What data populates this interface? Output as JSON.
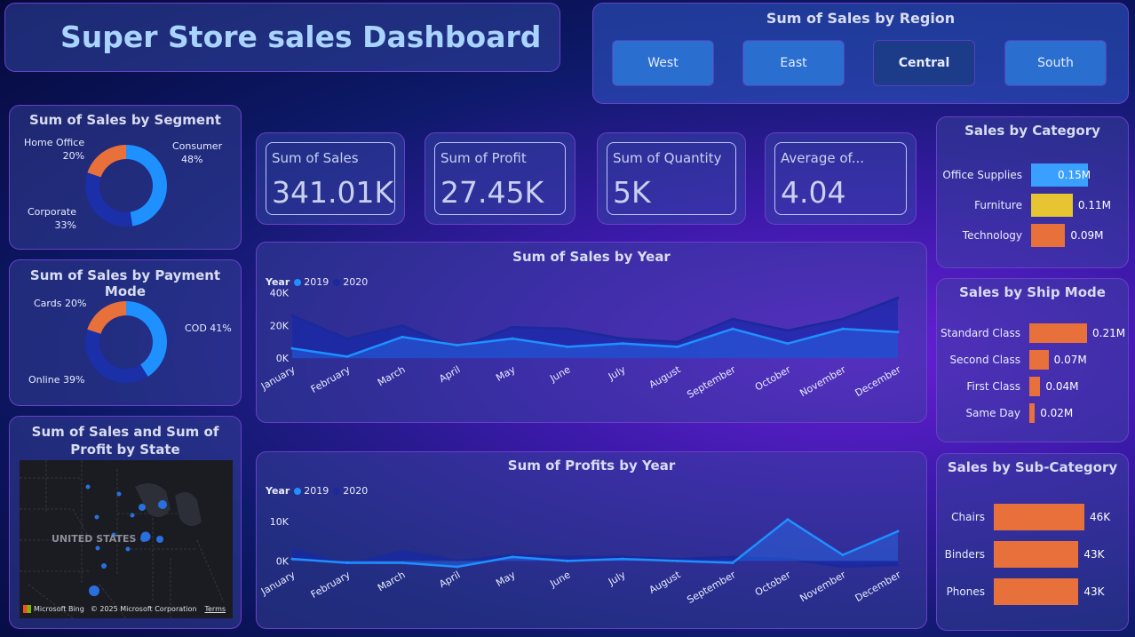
{
  "header": {
    "title": "Super Store sales Dashboard"
  },
  "region": {
    "title": "Sum of Sales by Region",
    "buttons": [
      "West",
      "East",
      "Central",
      "South"
    ],
    "selected": "Central"
  },
  "kpis": [
    {
      "label": "Sum of Sales",
      "value": "341.01K"
    },
    {
      "label": "Sum of Profit",
      "value": "27.45K"
    },
    {
      "label": "Sum of Quantity",
      "value": "5K"
    },
    {
      "label": "Average of...",
      "value": "4.04"
    }
  ],
  "segment": {
    "title": "Sum of Sales by Segment",
    "slices": [
      {
        "name": "Consumer",
        "pct": "48%"
      },
      {
        "name": "Corporate",
        "pct": "33%"
      },
      {
        "name": "Home Office",
        "pct": "20%"
      }
    ]
  },
  "payment": {
    "title": "Sum of Sales by Payment Mode",
    "slices": [
      {
        "label": "COD 41%"
      },
      {
        "label": "Online 39%"
      },
      {
        "label": "Cards 20%"
      }
    ]
  },
  "map": {
    "title": "Sum of Sales and Sum of Profit by State",
    "country_label": "UNITED STATES",
    "attribution": "© 2025 Microsoft Corporation",
    "terms": "Terms",
    "brand": "Microsoft Bing"
  },
  "sales_year": {
    "title": "Sum of Sales by Year",
    "legend_title": "Year",
    "yticks": [
      "40K",
      "20K",
      "0K"
    ]
  },
  "profit_year": {
    "title": "Sum of Profits by Year",
    "legend_title": "Year",
    "yticks": [
      "10K",
      "0K"
    ]
  },
  "category": {
    "title": "Sales by Category",
    "items": [
      {
        "name": "Office Supplies",
        "label": "0.15M",
        "value": 0.15,
        "color": "#3aa0ff"
      },
      {
        "name": "Furniture",
        "label": "0.11M",
        "value": 0.11,
        "color": "#e6c432"
      },
      {
        "name": "Technology",
        "label": "0.09M",
        "value": 0.09,
        "color": "#e8703a"
      }
    ]
  },
  "shipmode": {
    "title": "Sales by Ship Mode",
    "items": [
      {
        "name": "Standard Class",
        "label": "0.21M",
        "value": 0.21
      },
      {
        "name": "Second Class",
        "label": "0.07M",
        "value": 0.07
      },
      {
        "name": "First Class",
        "label": "0.04M",
        "value": 0.04
      },
      {
        "name": "Same Day",
        "label": "0.02M",
        "value": 0.02
      }
    ]
  },
  "subcategory": {
    "title": "Sales by Sub-Category",
    "items": [
      {
        "name": "Chairs",
        "label": "46K",
        "value": 46
      },
      {
        "name": "Binders",
        "label": "43K",
        "value": 43
      },
      {
        "name": "Phones",
        "label": "43K",
        "value": 43
      }
    ]
  },
  "colors": {
    "series_2019": "#1e90ff",
    "series_2020": "#1a2a9a",
    "accent_orange": "#e8703a"
  },
  "chart_data": [
    {
      "type": "area",
      "title": "Sum of Sales by Year",
      "x": [
        "January",
        "February",
        "March",
        "April",
        "May",
        "June",
        "July",
        "August",
        "September",
        "October",
        "November",
        "December"
      ],
      "ylim": [
        0,
        40000
      ],
      "series": [
        {
          "name": "2019",
          "values": [
            6000,
            1000,
            13000,
            8000,
            12000,
            7000,
            9000,
            7000,
            18000,
            9000,
            18000,
            16000
          ]
        },
        {
          "name": "2020",
          "values": [
            26000,
            12000,
            20000,
            6000,
            19000,
            18000,
            12000,
            10000,
            24000,
            17000,
            24000,
            37000
          ]
        }
      ]
    },
    {
      "type": "area",
      "title": "Sum of Profits by Year",
      "x": [
        "January",
        "February",
        "March",
        "April",
        "May",
        "June",
        "July",
        "August",
        "September",
        "October",
        "November",
        "December"
      ],
      "ylim": [
        -2000,
        12000
      ],
      "series": [
        {
          "name": "2019",
          "values": [
            500,
            -500,
            -500,
            -1500,
            1000,
            0,
            500,
            0,
            -500,
            10500,
            1500,
            7500
          ]
        },
        {
          "name": "2020",
          "values": [
            3000,
            -1000,
            2500,
            0,
            1500,
            1000,
            1000,
            500,
            1000,
            500,
            -1500,
            -1000
          ]
        }
      ]
    },
    {
      "type": "pie",
      "title": "Sum of Sales by Segment",
      "categories": [
        "Consumer",
        "Corporate",
        "Home Office"
      ],
      "values": [
        48,
        33,
        20
      ]
    },
    {
      "type": "pie",
      "title": "Sum of Sales by Payment Mode",
      "categories": [
        "COD",
        "Online",
        "Cards"
      ],
      "values": [
        41,
        39,
        20
      ]
    },
    {
      "type": "bar",
      "title": "Sales by Category",
      "categories": [
        "Office Supplies",
        "Furniture",
        "Technology"
      ],
      "values": [
        0.15,
        0.11,
        0.09
      ]
    },
    {
      "type": "bar",
      "title": "Sales by Ship Mode",
      "categories": [
        "Standard Class",
        "Second Class",
        "First Class",
        "Same Day"
      ],
      "values": [
        0.21,
        0.07,
        0.04,
        0.02
      ]
    },
    {
      "type": "bar",
      "title": "Sales by Sub-Category",
      "categories": [
        "Chairs",
        "Binders",
        "Phones"
      ],
      "values": [
        46,
        43,
        43
      ]
    }
  ]
}
